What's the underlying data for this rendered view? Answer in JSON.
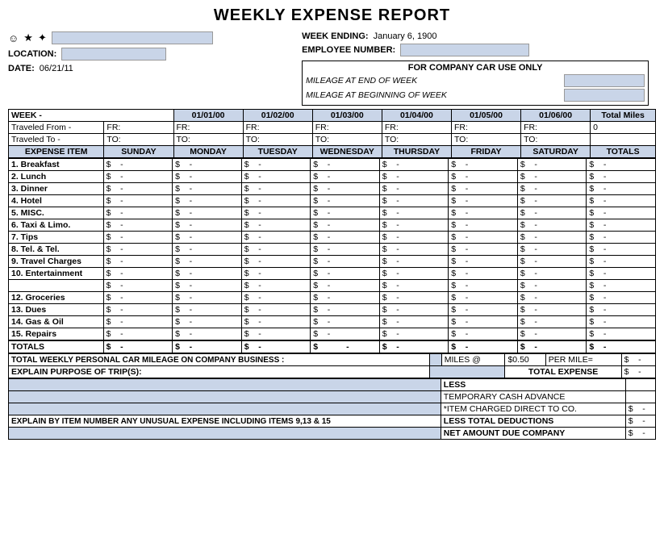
{
  "title": "WEEKLY EXPENSE REPORT",
  "header": {
    "week_ending_label": "WEEK ENDING:",
    "week_ending_value": "January 6, 1900",
    "employee_number_label": "EMPLOYEE NUMBER:",
    "location_label": "LOCATION:",
    "date_label": "DATE:",
    "date_value": "06/21/11",
    "for_company_car": "FOR COMPANY CAR USE ONLY",
    "mileage_end": "MILEAGE AT END OF WEEK",
    "mileage_begin": "MILEAGE AT BEGINNING OF WEEK"
  },
  "week_row": {
    "label": "WEEK -",
    "days": [
      "01/01/00",
      "01/02/00",
      "01/03/00",
      "01/04/00",
      "01/05/00",
      "01/06/00"
    ],
    "total_miles": "Total Miles"
  },
  "traveled_from": {
    "label": "Traveled From -",
    "prefix": "FR:",
    "days": [
      "",
      "",
      "",
      "",
      "",
      ""
    ]
  },
  "traveled_to": {
    "label": "Traveled To -",
    "prefix": "TO:",
    "days": [
      "",
      "",
      "",
      "",
      "",
      ""
    ]
  },
  "column_headers": {
    "expense_item": "EXPENSE ITEM",
    "sunday": "SUNDAY",
    "monday": "MONDAY",
    "tuesday": "TUESDAY",
    "wednesday": "WEDNESDAY",
    "thursday": "THURSDAY",
    "friday": "FRIDAY",
    "saturday": "SATURDAY",
    "totals": "TOTALS"
  },
  "expense_items": [
    "1. Breakfast",
    "2. Lunch",
    "3. Dinner",
    "4. Hotel",
    "5. MISC.",
    "6. Taxi & Limo.",
    "7. Tips",
    "8. Tel. & Tel.",
    "9. Travel Charges",
    "10. Entertainment",
    "",
    "12. Groceries",
    "13. Dues",
    "14. Gas & Oil",
    "15. Repairs"
  ],
  "totals_row_label": "TOTALS",
  "mileage_section": {
    "label": "TOTAL WEEKLY PERSONAL CAR MILEAGE ON COMPANY BUSINESS :",
    "miles_at": "MILES @",
    "rate": "$0.50",
    "per_mile": "PER MILE=",
    "dollar": "$",
    "dash": "-"
  },
  "purpose_section": {
    "label": "EXPLAIN PURPOSE OF TRIP(S):",
    "total_expense_label": "TOTAL EXPENSE",
    "dollar": "$",
    "dash": "-"
  },
  "summary": {
    "less": "LESS",
    "temp_cash": "TEMPORARY CASH ADVANCE",
    "item_charged": "*ITEM CHARGED DIRECT TO CO.",
    "less_deductions": "LESS TOTAL DEDUCTIONS",
    "net_amount": "NET AMOUNT DUE COMPANY",
    "dollar": "$",
    "dash": "-"
  },
  "bottom_label": "EXPLAIN BY ITEM NUMBER ANY UNUSUAL EXPENSE INCLUDING ITEMS 9,13 & 15"
}
